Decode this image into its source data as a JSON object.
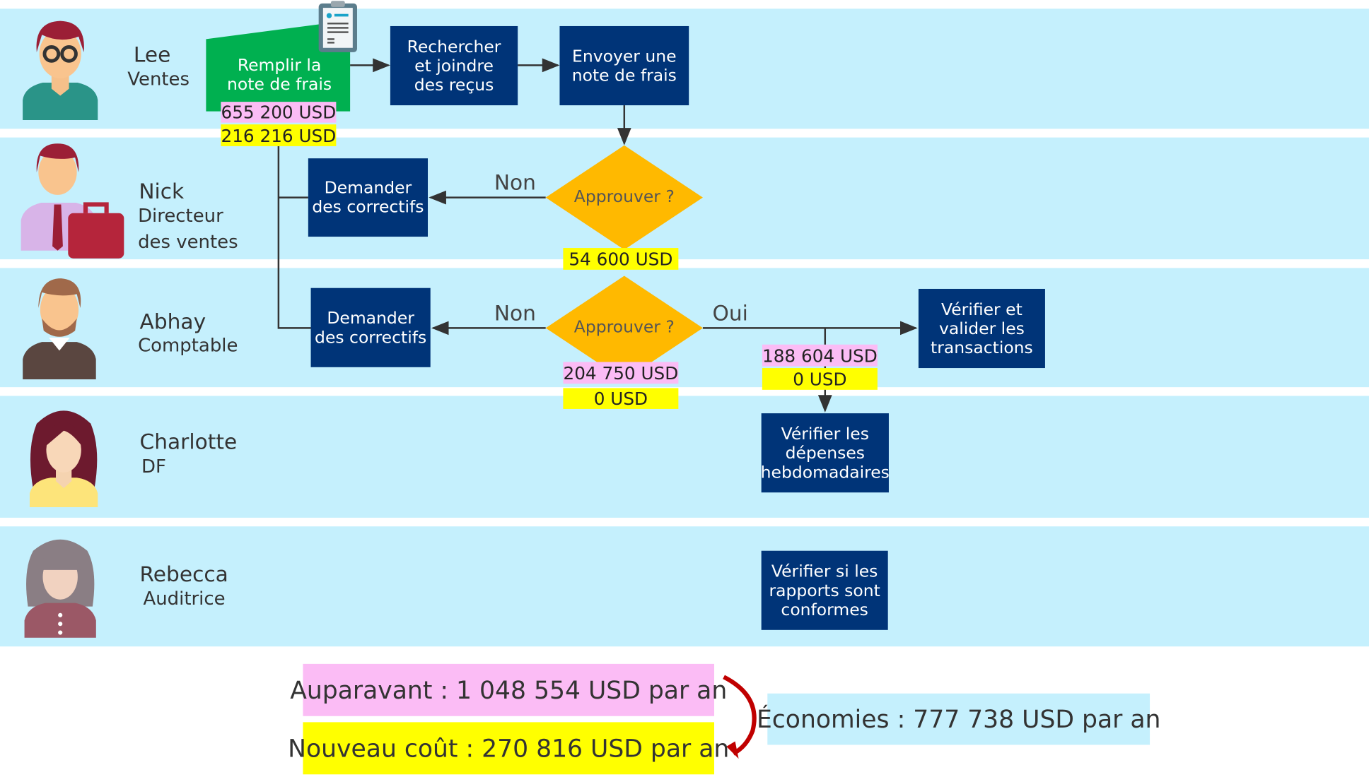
{
  "colors": {
    "lane": "#c5f0fd",
    "task": "#003478",
    "start": "#00b050",
    "decision": "#ffb900",
    "before": "#fbbcf5",
    "after": "#ffff00",
    "savings": "#c5f0fd",
    "arrow_red": "#c00000"
  },
  "lanes": [
    {
      "name": "Lee",
      "role": "Ventes",
      "icon": "man-glasses-avatar-icon"
    },
    {
      "name": "Nick",
      "role1": "Directeur",
      "role2": "des ventes",
      "icon": "man-briefcase-avatar-icon"
    },
    {
      "name": "Abhay",
      "role": "Comptable",
      "icon": "bearded-man-avatar-icon"
    },
    {
      "name": "Charlotte",
      "role": "DF",
      "icon": "woman-avatar-icon"
    },
    {
      "name": "Rebecca",
      "role": "Auditrice",
      "icon": "woman-gray-hair-avatar-icon"
    }
  ],
  "start": {
    "label": "Remplir la\nnote de frais",
    "before": "655 200 USD",
    "after": "216 216 USD",
    "icon": "clipboard-form-icon"
  },
  "tasks": {
    "search": "Rechercher\net joindre\ndes reçus",
    "send": "Envoyer une\nnote de frais",
    "fix1": "Demander\ndes correctifs",
    "fix2": "Demander\ndes correctifs",
    "validate": "Vérifier et\nvalider les\ntransactions",
    "weekly": "Vérifier les\ndépenses\nhebdomadaires",
    "audit": "Vérifier si les\nrapports sont\nconformes"
  },
  "decisions": [
    {
      "label": "Approuver ?",
      "no": "Non",
      "after": "54 600 USD"
    },
    {
      "label": "Approuver ?",
      "no": "Non",
      "yes": "Oui",
      "before": "204 750 USD",
      "after": "0 USD"
    }
  ],
  "yes_branch": {
    "before": "188 604 USD",
    "after": "0 USD"
  },
  "summary": {
    "before": "Auparavant : 1 048 554 USD par an",
    "after": "Nouveau coût : 270 816 USD par an",
    "savings": "Économies : 777 738 USD par an"
  }
}
